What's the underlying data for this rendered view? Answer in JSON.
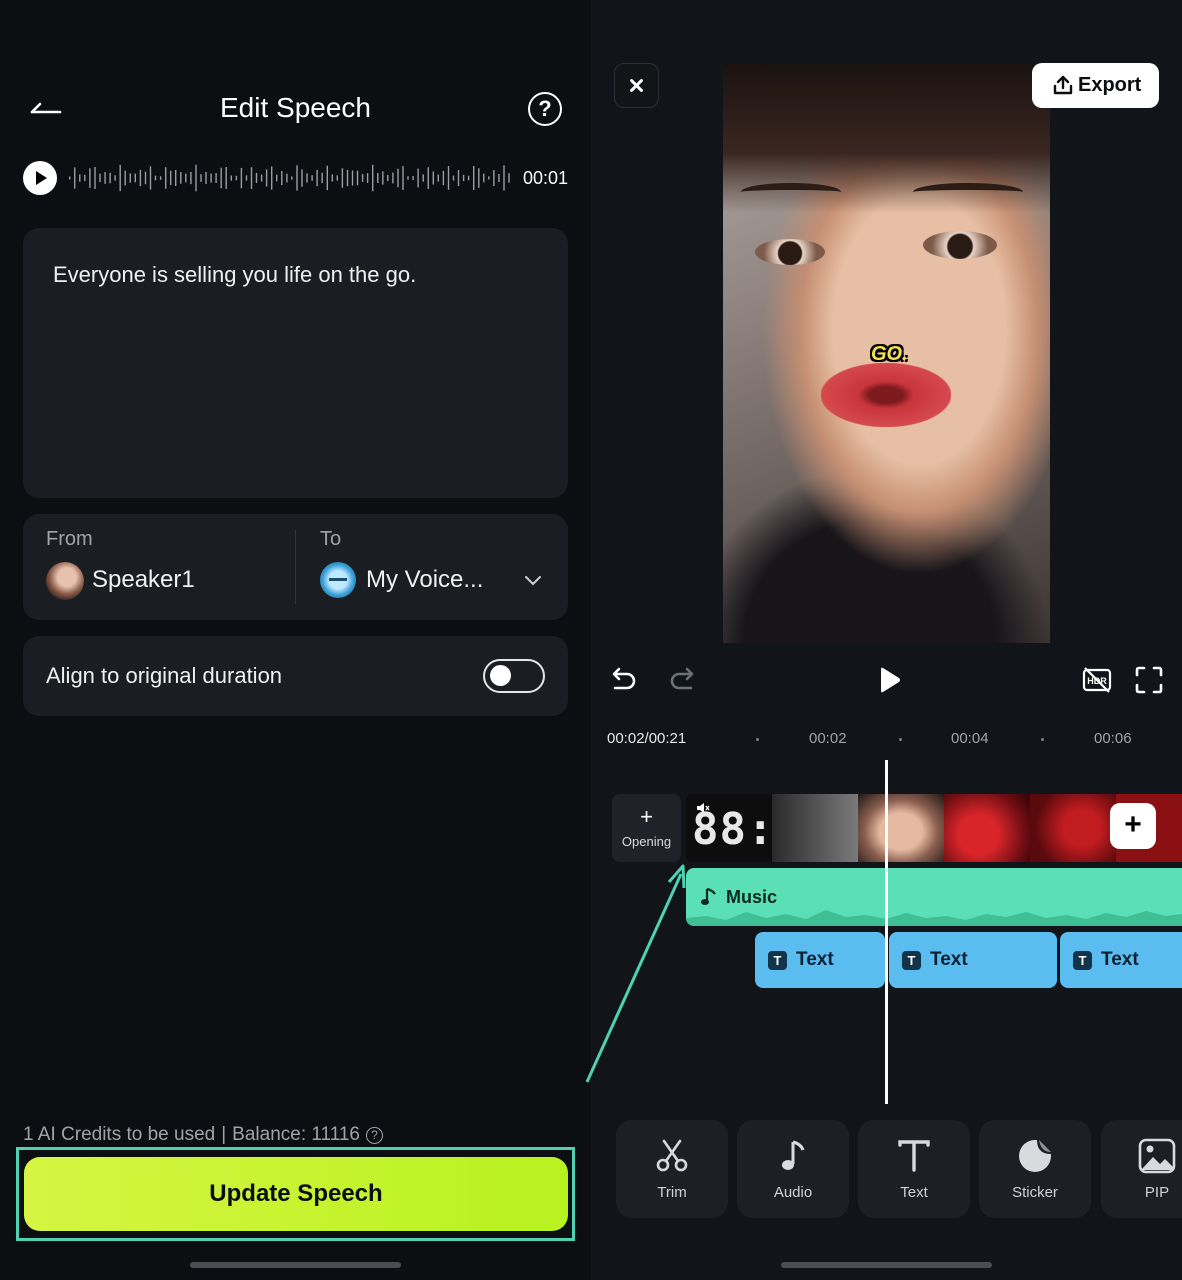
{
  "left_panel": {
    "title": "Edit Speech",
    "player": {
      "duration": "00:01"
    },
    "speech_text": "Everyone is selling you life on the go.",
    "voice": {
      "from_label": "From",
      "from_speaker": "Speaker1",
      "to_label": "To",
      "to_voice": "My Voice..."
    },
    "align": {
      "label": "Align to original duration",
      "enabled": false
    },
    "credits": {
      "used": "1 AI Credits to be used",
      "separator": "|",
      "balance": "Balance: 11116",
      "help": "?"
    },
    "update_button": "Update Speech"
  },
  "right_panel": {
    "export_label": "Export",
    "caption_overlay": "GO.",
    "timeline": {
      "current_time": "00:02/00:21",
      "ticks": [
        "00:02",
        "00:04",
        "00:06"
      ],
      "opening_label": "Opening",
      "clip_digits": "88:",
      "music_label": "Music",
      "text_clips": [
        "Text",
        "Text",
        "Text"
      ]
    },
    "tools": [
      {
        "label": "Trim",
        "icon": "scissors-icon"
      },
      {
        "label": "Audio",
        "icon": "music-note-icon"
      },
      {
        "label": "Text",
        "icon": "text-icon"
      },
      {
        "label": "Sticker",
        "icon": "sticker-icon"
      },
      {
        "label": "PIP",
        "icon": "image-icon"
      }
    ]
  },
  "colors": {
    "accent_green": "#b7f21f",
    "annotation_teal": "#4fd1b3",
    "music_track": "#5ae0b4",
    "text_track": "#5bbcf0"
  }
}
